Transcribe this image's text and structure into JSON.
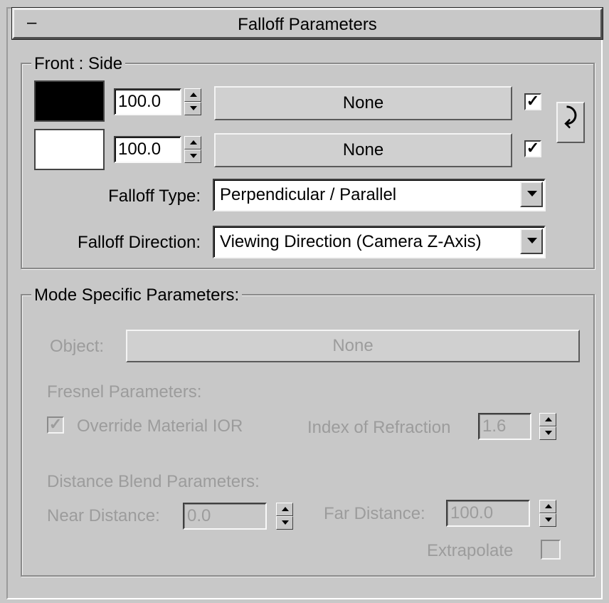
{
  "rollout": {
    "collapse_symbol": "–",
    "title": "Falloff Parameters"
  },
  "front_side": {
    "group_label": "Front : Side",
    "row1": {
      "swatch_color": "#000000",
      "amount": "100.0",
      "map_label": "None",
      "checked": "✓"
    },
    "row2": {
      "swatch_color": "#ffffff",
      "amount": "100.0",
      "map_label": "None",
      "checked": "✓"
    },
    "swap_icon": "swap-arrow-icon",
    "swap_glyph": "⤸",
    "falloff_type_label": "Falloff Type:",
    "falloff_type_value": "Perpendicular / Parallel",
    "falloff_direction_label": "Falloff Direction:",
    "falloff_direction_value": "Viewing Direction (Camera Z-Axis)"
  },
  "mode_specific": {
    "group_label": "Mode Specific Parameters:",
    "object_label": "Object:",
    "object_button": "None",
    "fresnel_heading": "Fresnel Parameters:",
    "override_ior_label": "Override Material IOR",
    "override_ior_checked": "✓",
    "ior_label": "Index of Refraction",
    "ior_value": "1.6",
    "distance_heading": "Distance Blend Parameters:",
    "near_label": "Near Distance:",
    "near_value": "0.0",
    "far_label": "Far Distance:",
    "far_value": "100.0",
    "extrapolate_label": "Extrapolate"
  }
}
